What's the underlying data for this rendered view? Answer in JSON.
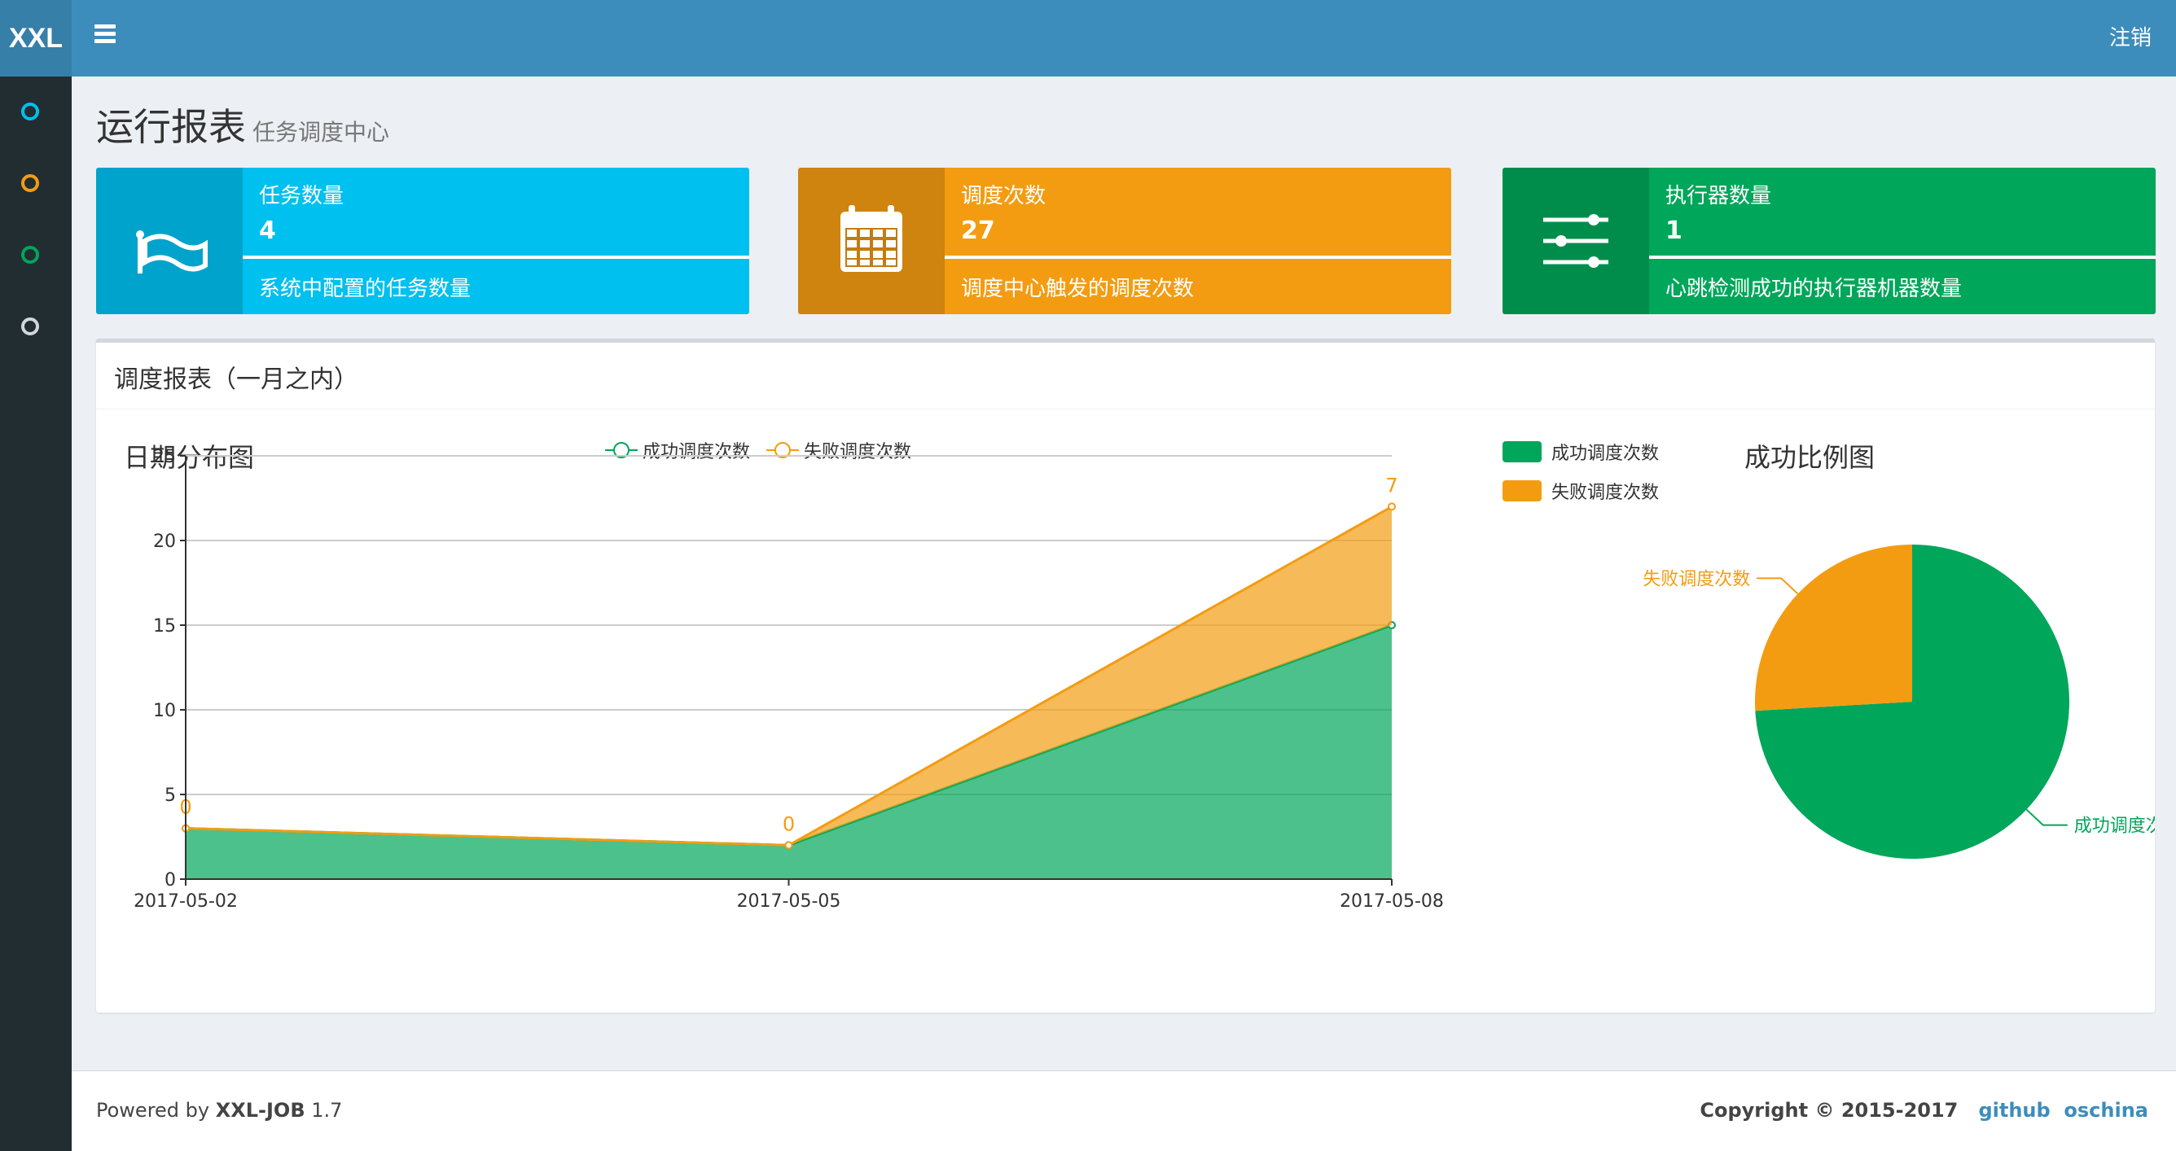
{
  "header": {
    "logo": "XXL",
    "logout": "注销",
    "menu_icon": "bars-icon"
  },
  "sidebar": {
    "items": [
      {
        "icon": "circle-icon",
        "color": "#00c0ef"
      },
      {
        "icon": "circle-icon",
        "color": "#f39c12"
      },
      {
        "icon": "circle-icon",
        "color": "#00a65a"
      },
      {
        "icon": "circle-icon",
        "color": "#d2d6de"
      }
    ]
  },
  "page": {
    "title": "运行报表",
    "subtitle": "任务调度中心"
  },
  "boxes": [
    {
      "title": "任务数量",
      "value": "4",
      "desc": "系统中配置的任务数量",
      "color": "#00c0ef",
      "icon": "flag-icon"
    },
    {
      "title": "调度次数",
      "value": "27",
      "desc": "调度中心触发的调度次数",
      "color": "#f39c12",
      "icon": "calendar-icon"
    },
    {
      "title": "执行器数量",
      "value": "1",
      "desc": "心跳检测成功的执行器机器数量",
      "color": "#00a65a",
      "icon": "sliders-icon"
    }
  ],
  "panel": {
    "title": "调度报表（一月之内）"
  },
  "chart_data": [
    {
      "type": "area",
      "stacked": true,
      "title": "日期分布图",
      "categories": [
        "2017-05-02",
        "2017-05-05",
        "2017-05-08"
      ],
      "series": [
        {
          "name": "成功调度次数",
          "values": [
            3,
            2,
            15
          ],
          "color": "#00a65a"
        },
        {
          "name": "失败调度次数",
          "values": [
            0,
            0,
            7
          ],
          "color": "#f39c12",
          "data_labels": [
            "0",
            "0",
            "7"
          ]
        }
      ],
      "ylim": [
        0,
        25
      ],
      "yticks": [
        "0",
        "5",
        "10",
        "15",
        "20",
        "25"
      ],
      "grid": true,
      "legend": "top"
    },
    {
      "type": "pie",
      "title": "成功比例图",
      "slices": [
        {
          "name": "成功调度次数",
          "value": 20,
          "color": "#00a65a"
        },
        {
          "name": "失败调度次数",
          "value": 7,
          "color": "#f39c12"
        }
      ],
      "legend": "top-left"
    }
  ],
  "footer": {
    "powered_prefix": "Powered by ",
    "powered_name": "XXL-JOB",
    "version": " 1.7",
    "copyright": "Copyright © 2015-2017",
    "links": [
      "github",
      "oschina"
    ]
  }
}
